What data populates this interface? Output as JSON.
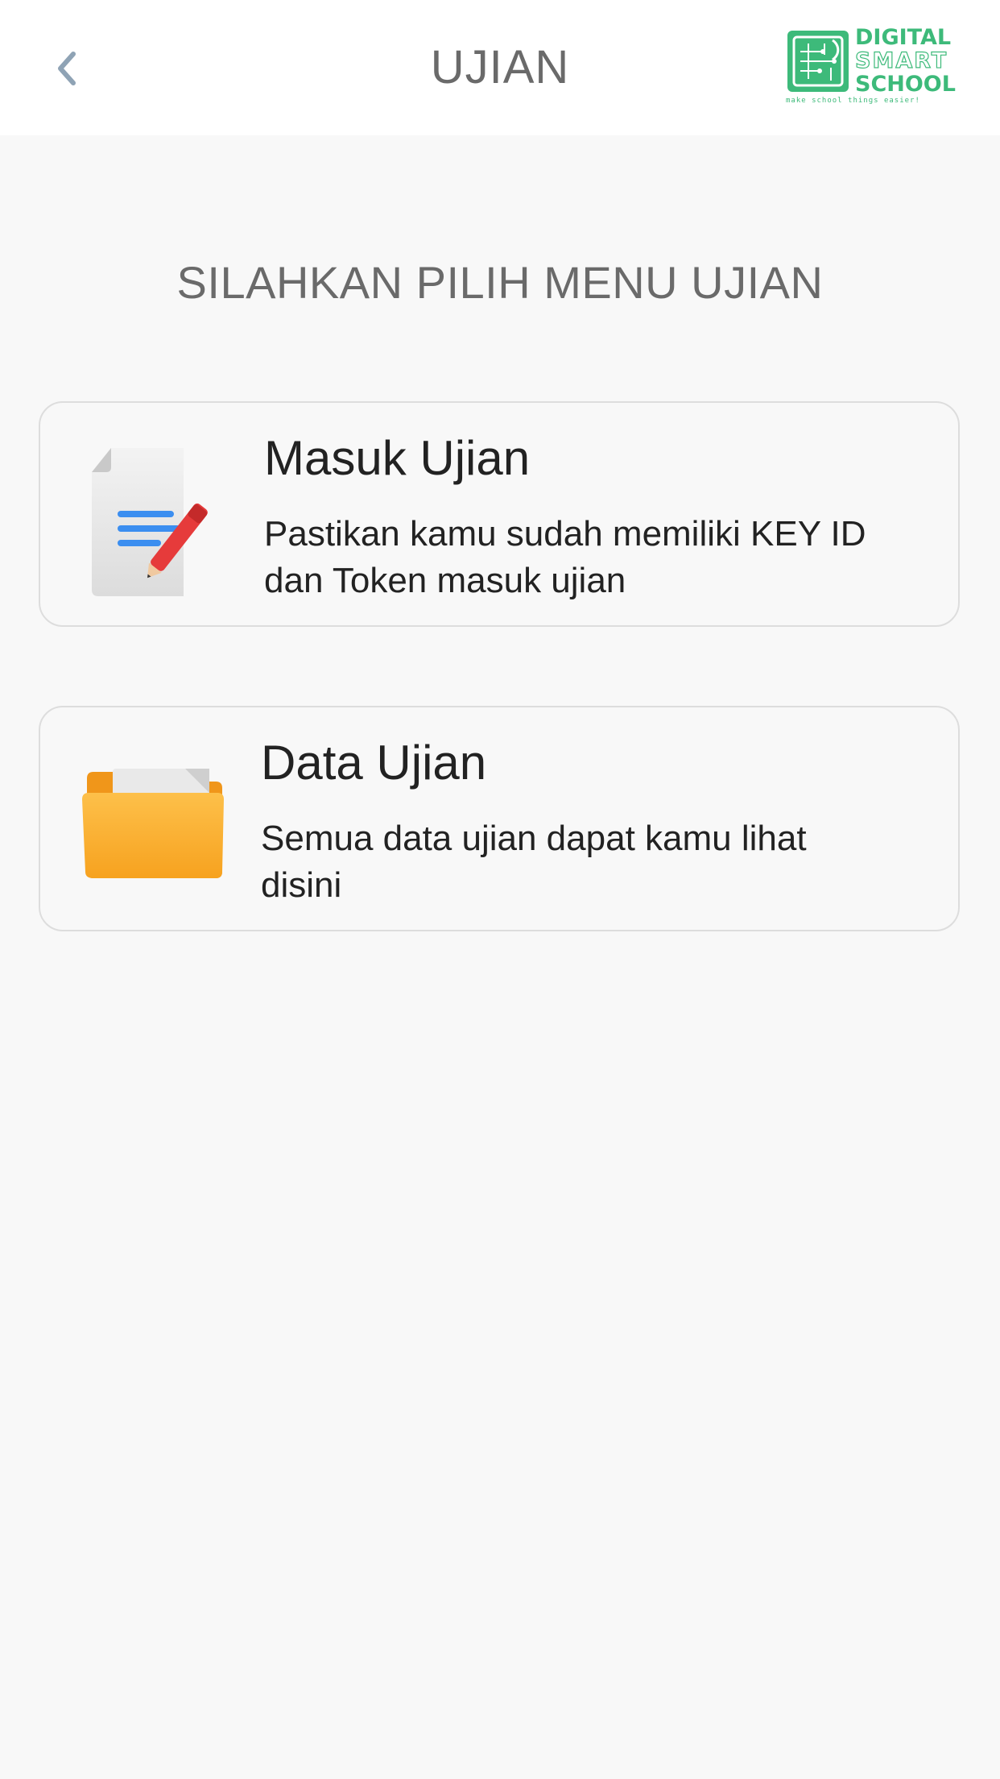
{
  "header": {
    "title": "UJIAN",
    "back_icon": "chevron-left-icon",
    "logo": {
      "line1": "DIGITAL",
      "line2": "SMART",
      "line3": "SCHOOL",
      "tagline": "make school things easier!"
    }
  },
  "main": {
    "heading": "SILAHKAN PILIH MENU UJIAN",
    "menu_items": [
      {
        "icon": "document-edit-icon",
        "title": "Masuk Ujian",
        "description": "Pastikan kamu sudah memiliki KEY ID dan Token masuk ujian"
      },
      {
        "icon": "folder-icon",
        "title": "Data Ujian",
        "description": "Semua data ujian dapat kamu lihat disini"
      }
    ]
  },
  "colors": {
    "background": "#f8f8f8",
    "header_bg": "#ffffff",
    "brand_green": "#3dba7a",
    "folder_orange": "#fbab2c",
    "pen_red": "#e63b3b",
    "doc_lines_blue": "#3b8ef0"
  }
}
